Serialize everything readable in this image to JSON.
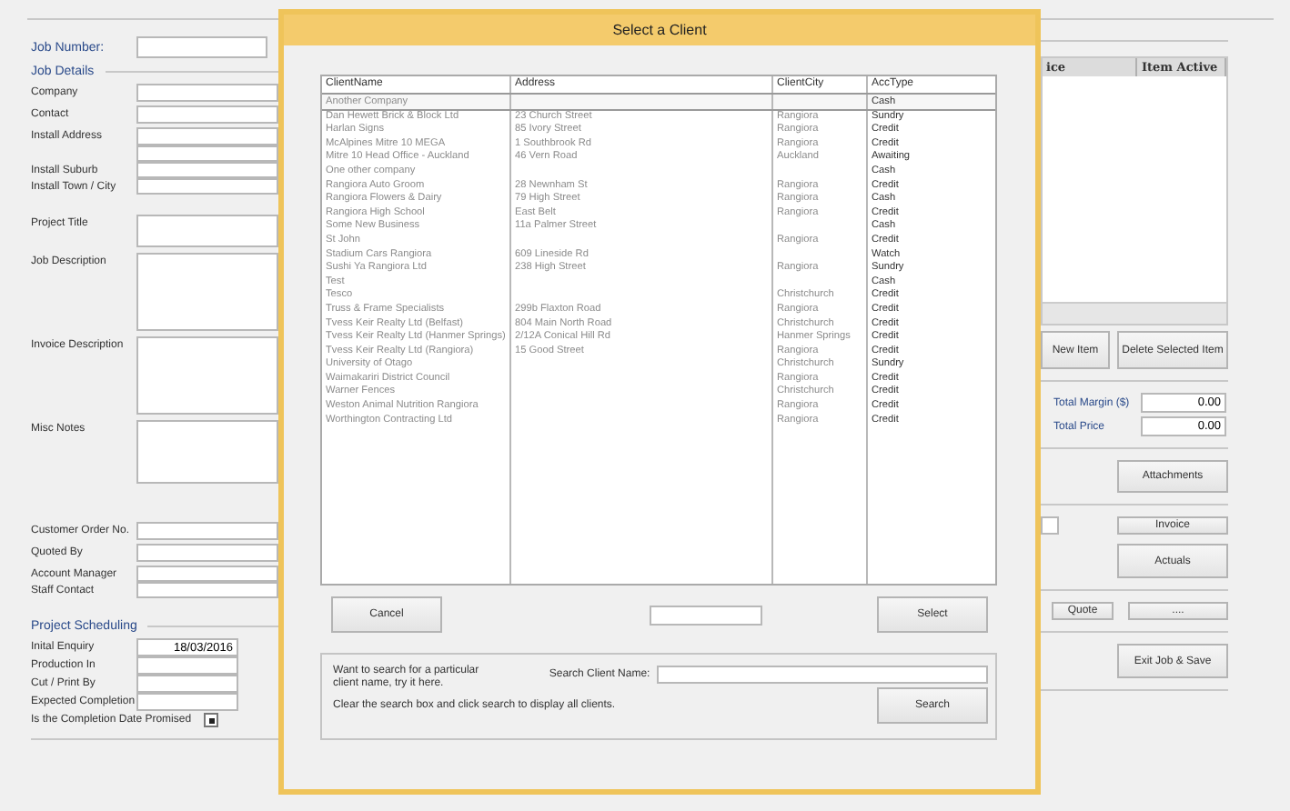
{
  "job_form": {
    "job_number": {
      "label": "Job Number:"
    },
    "job_details": {
      "title": "Job Details",
      "groups": [
        [
          {
            "label": "Company",
            "kind": "line"
          },
          {
            "label": "Contact",
            "kind": "line"
          },
          {
            "label": "Install Address",
            "kind": "double"
          },
          {
            "label": "Install Suburb",
            "kind": "tight"
          },
          {
            "label": "Install Town / City",
            "kind": "tight"
          }
        ],
        [
          {
            "label": "Project Title",
            "kind": "box-small"
          },
          {
            "label": "Job Description",
            "kind": "box-large"
          },
          {
            "label": "Invoice Description",
            "kind": "box-large"
          },
          {
            "label": "Misc Notes",
            "kind": "box-medium"
          }
        ],
        [
          {
            "label": "Customer Order No.",
            "kind": "line"
          },
          {
            "label": "Quoted By",
            "kind": "line"
          },
          {
            "label": "Account Manager",
            "kind": "tight"
          },
          {
            "label": "Staff Contact",
            "kind": "tight"
          }
        ]
      ]
    },
    "project_scheduling": {
      "title": "Project Scheduling",
      "fields": [
        {
          "label": "Inital Enquiry",
          "kind": "date",
          "value": "18/03/2016"
        },
        {
          "label": "Production In",
          "kind": "date"
        },
        {
          "label": "Cut / Print By",
          "kind": "date"
        },
        {
          "label": "Expected Completion",
          "kind": "date"
        },
        {
          "label": "Is the Completion Date Promised",
          "kind": "checkbox",
          "checked": true
        }
      ]
    }
  },
  "items_panel": {
    "columns": [
      "ice",
      "Item Active"
    ],
    "buttons": [
      "New Item",
      "Delete Selected Item"
    ],
    "totals": [
      {
        "label": "Total Margin ($)",
        "value": "0.00"
      },
      {
        "label": "Total Price",
        "value": "0.00"
      }
    ],
    "attachments_button": "Attachments",
    "invoice_button": "Invoice",
    "actuals_button": "Actuals",
    "quote_button": "Quote",
    "more_button": "....",
    "exit_button": "Exit Job & Save"
  },
  "dialog": {
    "title": "Select a Client",
    "columns": [
      "ClientName",
      "Address",
      "ClientCity",
      "AccType"
    ],
    "rows": [
      {
        "name": "Another Company",
        "address": "",
        "city": "",
        "acc_type": "Cash",
        "selected": true
      },
      {
        "name": "Dan Hewett Brick & Block Ltd",
        "address": "23 Church Street",
        "city": "Rangiora",
        "acc_type": "Sundry",
        "selected": false
      },
      {
        "name": "Harlan Signs",
        "address": "85 Ivory Street",
        "city": "Rangiora",
        "acc_type": "Credit",
        "selected": false
      },
      {
        "name": "McAlpines Mitre 10 MEGA",
        "address": "1 Southbrook Rd",
        "city": "Rangiora",
        "acc_type": "Credit",
        "selected": false
      },
      {
        "name": "Mitre 10 Head Office - Auckland",
        "address": "46 Vern Road",
        "city": "Auckland",
        "acc_type": "Awaiting",
        "selected": false
      },
      {
        "name": "One other company",
        "address": "",
        "city": "",
        "acc_type": "Cash",
        "selected": false
      },
      {
        "name": "Rangiora Auto Groom",
        "address": "28 Newnham St",
        "city": "Rangiora",
        "acc_type": "Credit",
        "selected": false
      },
      {
        "name": "Rangiora Flowers & Dairy",
        "address": "79 High Street",
        "city": "Rangiora",
        "acc_type": "Cash",
        "selected": false
      },
      {
        "name": "Rangiora High School",
        "address": "East Belt",
        "city": "Rangiora",
        "acc_type": "Credit",
        "selected": false
      },
      {
        "name": "Some New Business",
        "address": "11a Palmer Street",
        "city": "",
        "acc_type": "Cash",
        "selected": false
      },
      {
        "name": "St John",
        "address": "",
        "city": "Rangiora",
        "acc_type": "Credit",
        "selected": false
      },
      {
        "name": "Stadium Cars Rangiora",
        "address": "609 Lineside Rd",
        "city": "",
        "acc_type": "Watch",
        "selected": false
      },
      {
        "name": "Sushi Ya Rangiora Ltd",
        "address": "238 High Street",
        "city": "Rangiora",
        "acc_type": "Sundry",
        "selected": false
      },
      {
        "name": "Test",
        "address": "",
        "city": "",
        "acc_type": "Cash",
        "selected": false
      },
      {
        "name": "Tesco",
        "address": "",
        "city": "Christchurch",
        "acc_type": "Credit",
        "selected": false
      },
      {
        "name": "Truss & Frame Specialists",
        "address": "299b Flaxton Road",
        "city": "Rangiora",
        "acc_type": "Credit",
        "selected": false
      },
      {
        "name": "Tvess Keir Realty Ltd (Belfast)",
        "address": "804 Main North Road",
        "city": "Christchurch",
        "acc_type": "Credit",
        "selected": false
      },
      {
        "name": "Tvess Keir Realty Ltd (Hanmer Springs)",
        "address": "2/12A Conical Hill Rd",
        "city": "Hanmer Springs",
        "acc_type": "Credit",
        "selected": false
      },
      {
        "name": "Tvess Keir Realty Ltd (Rangiora)",
        "address": "15 Good Street",
        "city": "Rangiora",
        "acc_type": "Credit",
        "selected": false
      },
      {
        "name": "University of Otago",
        "address": "",
        "city": "Christchurch",
        "acc_type": "Sundry",
        "selected": false
      },
      {
        "name": "Waimakariri District Council",
        "address": "",
        "city": "Rangiora",
        "acc_type": "Credit",
        "selected": false
      },
      {
        "name": "Warner Fences",
        "address": "",
        "city": "Christchurch",
        "acc_type": "Credit",
        "selected": false
      },
      {
        "name": "Weston Animal Nutrition Rangiora",
        "address": "",
        "city": "Rangiora",
        "acc_type": "Credit",
        "selected": false
      },
      {
        "name": "Worthington Contracting Ltd",
        "address": "",
        "city": "Rangiora",
        "acc_type": "Credit",
        "selected": false
      }
    ],
    "cancel_button": "Cancel",
    "select_button": "Select",
    "search": {
      "hint": "Want to search for a particular client name, try it here.",
      "label": "Search Client Name:",
      "note": "Clear the search box and click search to display all clients.",
      "button": "Search"
    }
  }
}
